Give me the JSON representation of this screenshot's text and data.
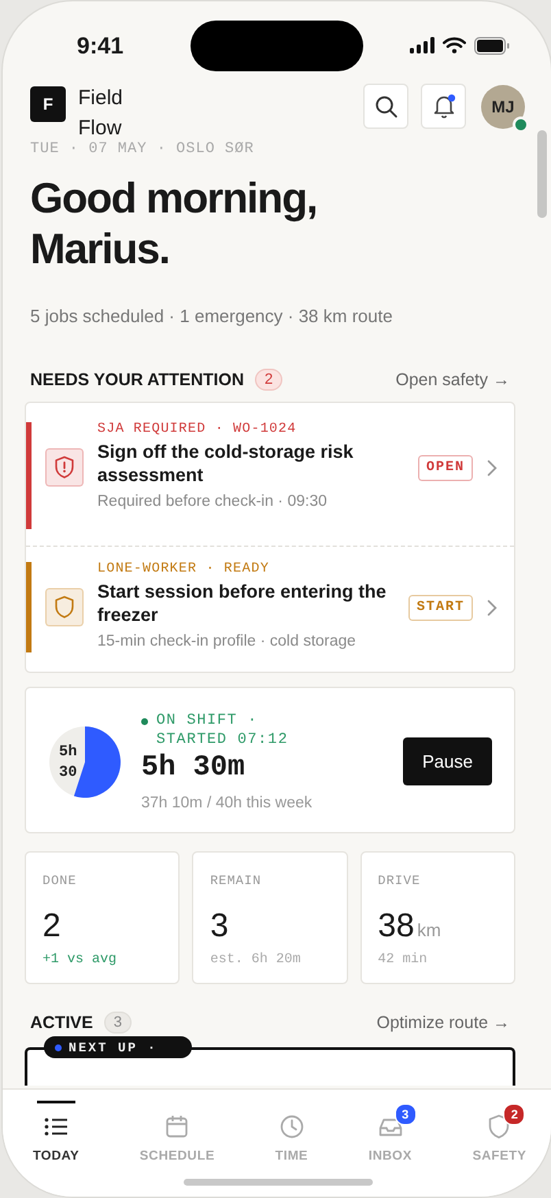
{
  "status_bar": {
    "time": "9:41"
  },
  "header": {
    "logo_letter": "F",
    "app_name": "Field Flow",
    "avatar_initials": "MJ",
    "notifications_unread": true,
    "online": true
  },
  "date_line": "TUE · 07 MAY · OSLO SØR",
  "greeting": "Good morning, Marius.",
  "summary": "5 jobs scheduled · 1 emergency · 38 km route",
  "attention": {
    "title": "NEEDS YOUR ATTENTION",
    "count": "2",
    "link": "Open safety →",
    "items": [
      {
        "kind": "alert",
        "color": "#d03a3a",
        "tag": "SJA REQUIRED · WO-1024",
        "title": "Sign off the cold-storage risk assessment",
        "subtitle": "Required before check-in · 09:30",
        "action": "OPEN"
      },
      {
        "kind": "shield",
        "color": "#c27a12",
        "tag": "LONE-WORKER · READY",
        "title": "Start session before entering the freezer",
        "subtitle": "15-min check-in profile · cold storage",
        "action": "START"
      }
    ]
  },
  "shift": {
    "ring_label": "5h 30",
    "status": "ON SHIFT · STARTED 07:12",
    "on": true,
    "duration": "5h 30m",
    "week": "37h 10m / 40h this week",
    "button": "Pause"
  },
  "stats": [
    {
      "label": "DONE",
      "value": "2",
      "note": "+1 vs avg",
      "positive": true
    },
    {
      "label": "REMAIN",
      "value": "3",
      "note": "est. 6h 20m",
      "positive": false
    },
    {
      "label": "DRIVE",
      "value": "38",
      "unit": "km",
      "note": "42 min",
      "positive": false
    }
  ],
  "active": {
    "title": "ACTIVE",
    "count": "3",
    "link": "Optimize route →",
    "next_label": "NEXT UP ·"
  },
  "tabs": [
    {
      "kind": "list",
      "label": "TODAY",
      "selected": true
    },
    {
      "kind": "calendar",
      "label": "SCHEDULE",
      "selected": false
    },
    {
      "kind": "clock",
      "label": "TIME",
      "selected": false
    },
    {
      "kind": "inbox",
      "label": "INBOX",
      "selected": false,
      "badge": "3",
      "color": "#2f5bff"
    },
    {
      "kind": "shield",
      "label": "SAFETY",
      "selected": false,
      "badge": "2",
      "color": "#c62828"
    }
  ]
}
